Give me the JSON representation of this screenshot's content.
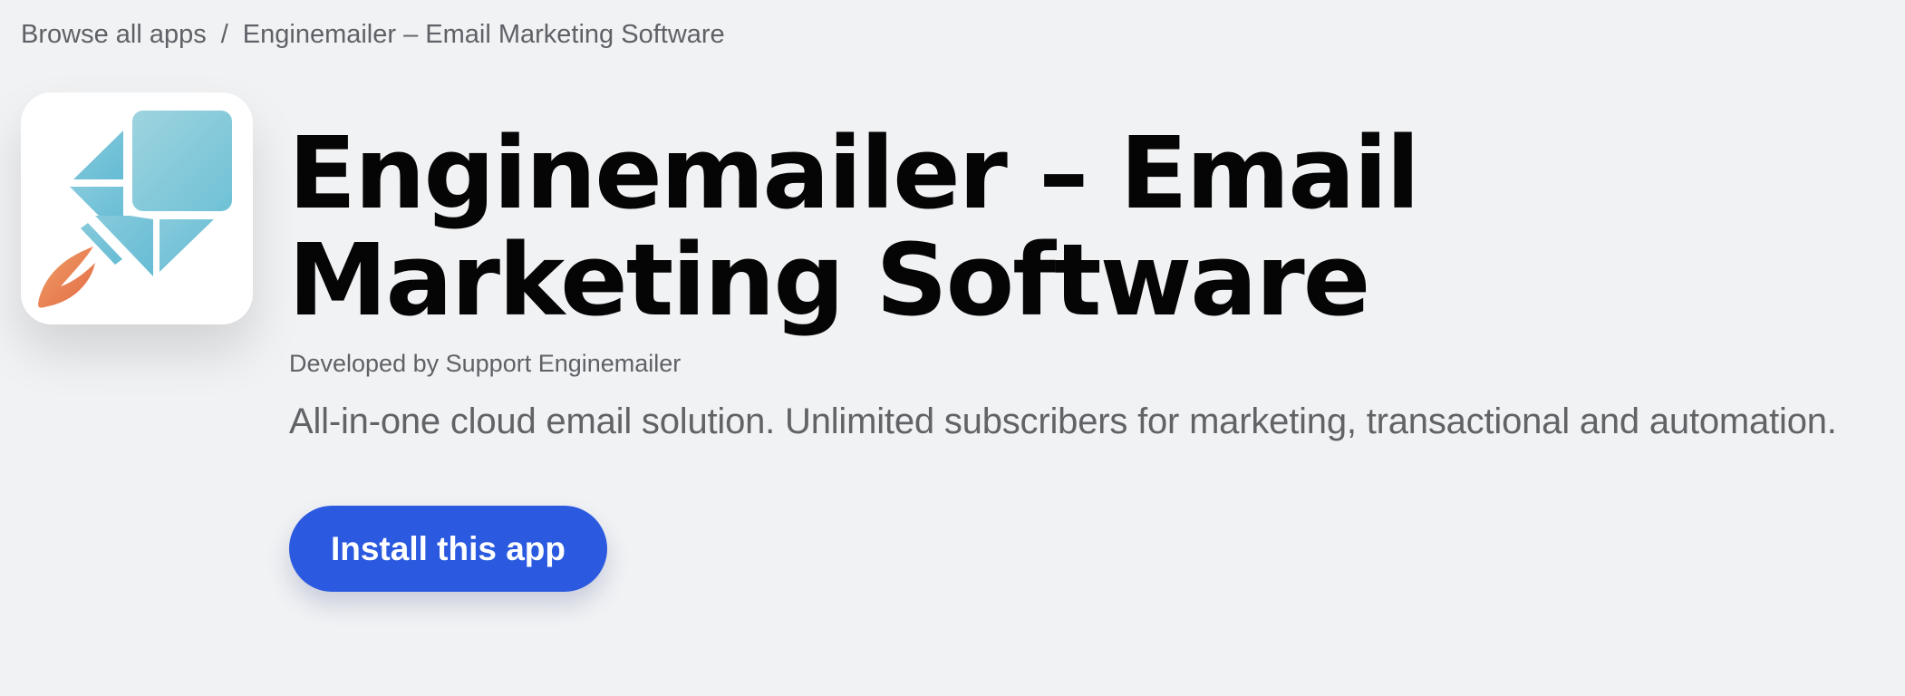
{
  "breadcrumb": {
    "root_label": "Browse all apps",
    "separator": "/",
    "current_label": "Enginemailer – Email Marketing Software"
  },
  "app": {
    "icon": "enginemailer-logo",
    "title": "Enginemailer – Email Marketing Software",
    "developer_prefix": "Developed by",
    "developer_name": "Support Enginemailer",
    "tagline": "All-in-one cloud email solution. Unlimited subscribers for marketing, transactional and automation."
  },
  "actions": {
    "install_label": "Install this app"
  },
  "colors": {
    "background": "#f1f2f4",
    "accent": "#2b5ae0",
    "logo_blue": "#7cc6d9",
    "logo_orange": "#e8784a"
  }
}
